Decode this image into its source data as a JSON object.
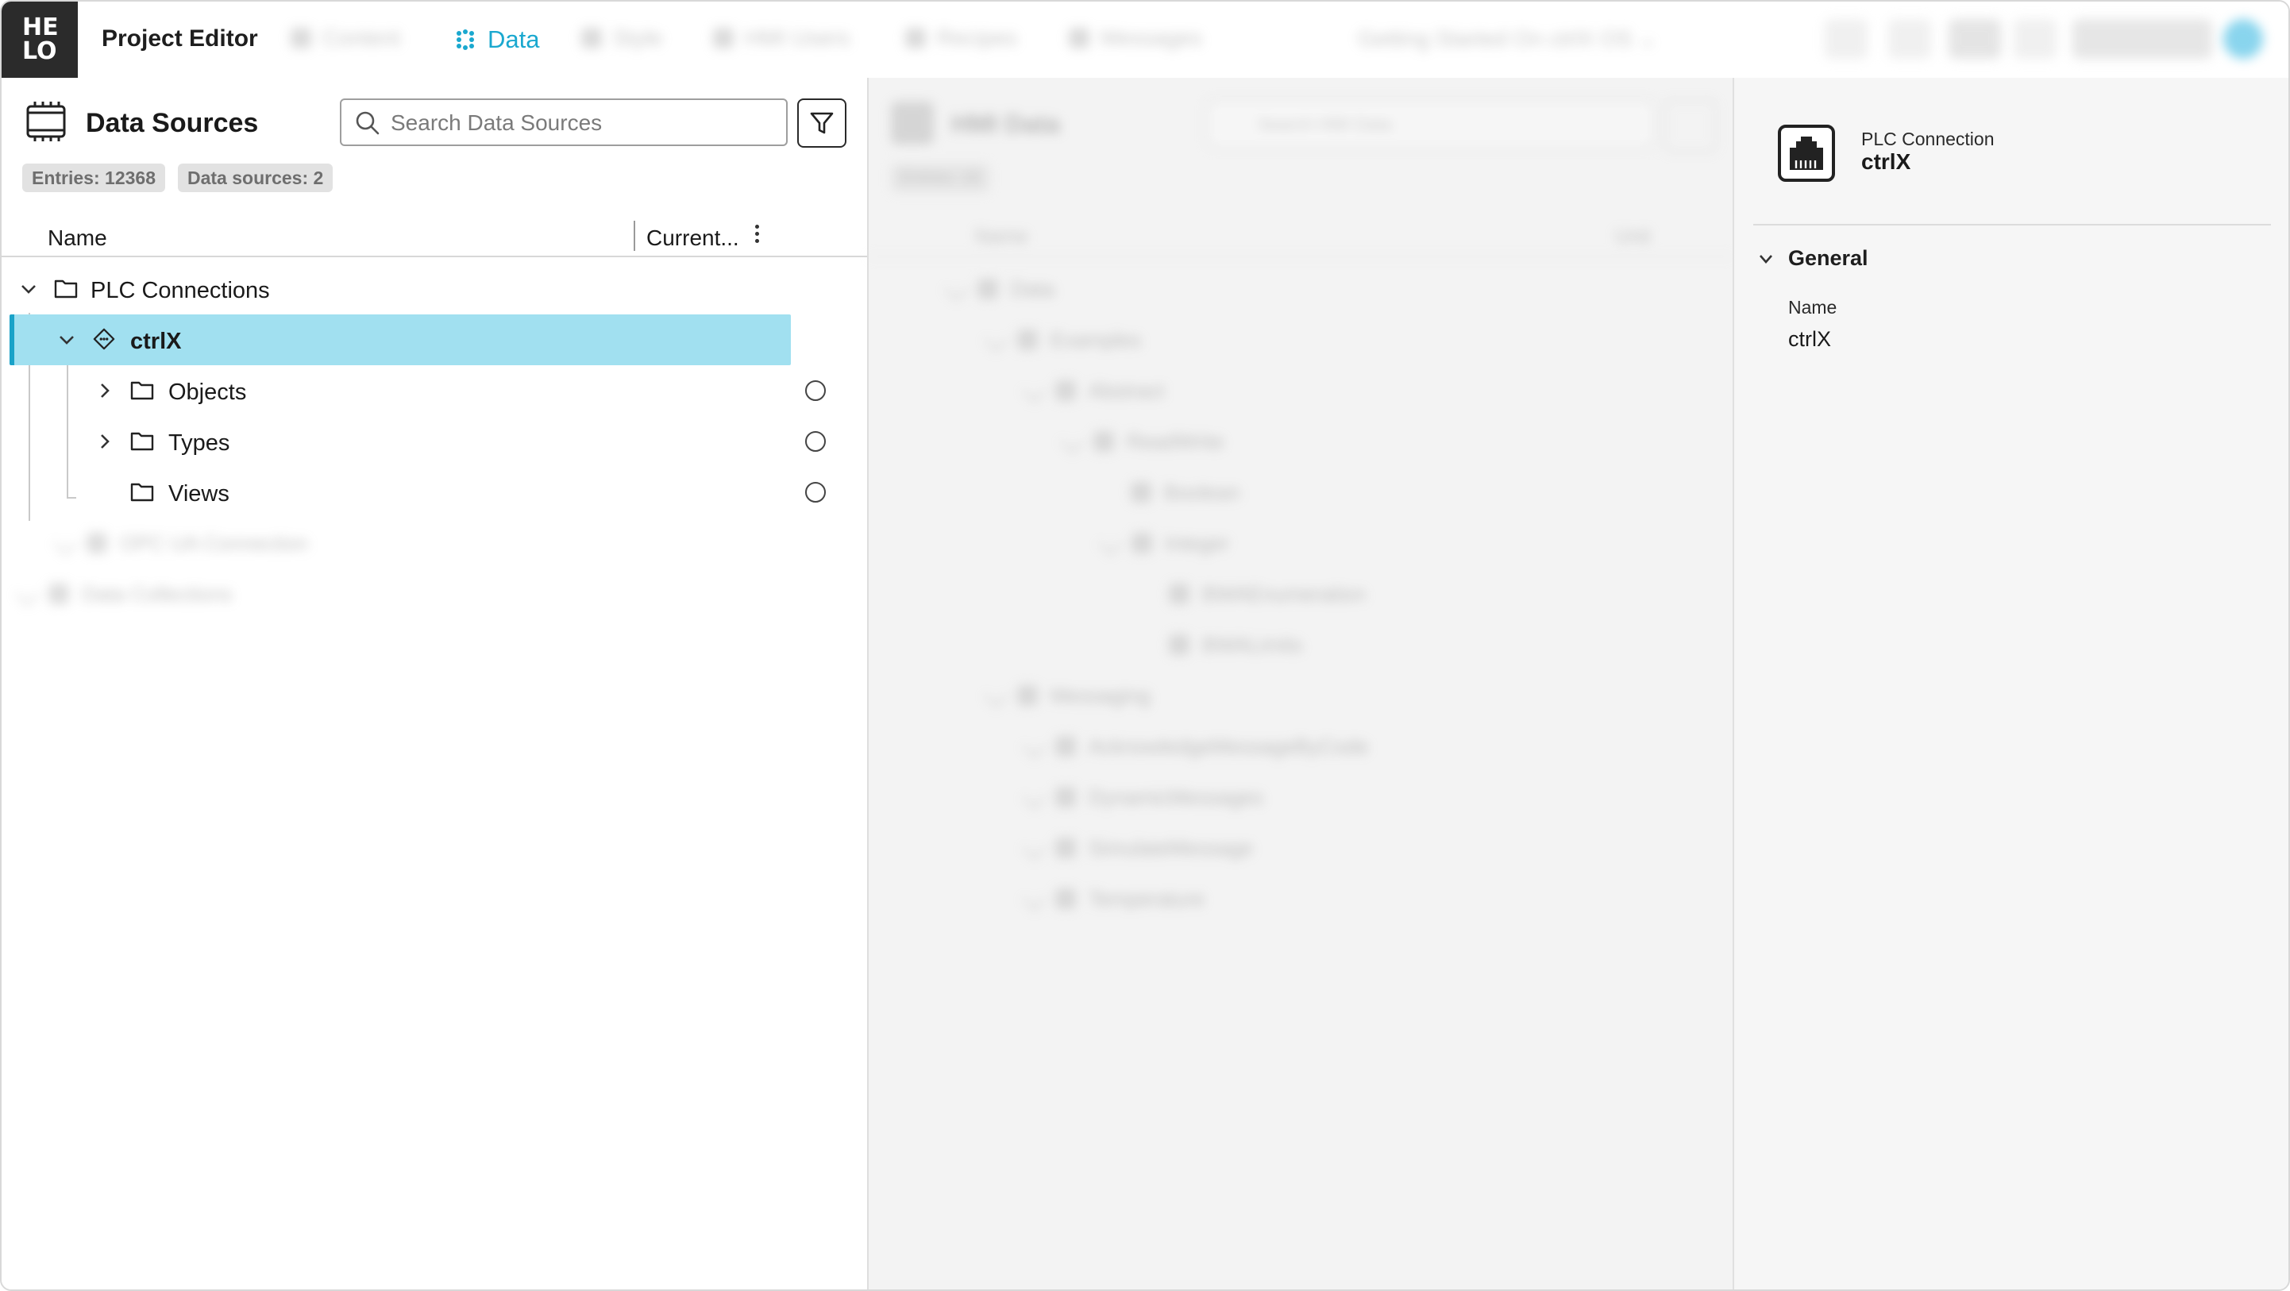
{
  "app": {
    "logo_top": "HE",
    "logo_bottom": "LO",
    "title": "Project Editor"
  },
  "nav": {
    "active_tab": "Data",
    "tabs": [
      "Content",
      "Data",
      "Style",
      "HMI Users",
      "Recipes",
      "Messages"
    ],
    "project": "Getting Started On ctrlX OS"
  },
  "data_sources": {
    "title": "Data Sources",
    "search_placeholder": "Search Data Sources",
    "entries_badge": "Entries: 12368",
    "sources_badge": "Data sources: 2",
    "col_name": "Name",
    "col_current": "Current...",
    "tree": {
      "root": "PLC Connections",
      "selected": "ctrlX",
      "children": [
        "Objects",
        "Types",
        "Views"
      ],
      "other_connection": "OPC UA Connection",
      "data_collections": "Data Collections"
    }
  },
  "hmi_data": {
    "title": "HMI Data",
    "search_placeholder": "Search HMI Data",
    "badge": "Entries: 16",
    "col_name": "Name",
    "col_unit": "Unit",
    "rows": [
      "Data",
      "Examples",
      "Abstract",
      "ReadWrite",
      "Boolean",
      "Integer",
      "BWAEnumeration",
      "BWALimits",
      "Messaging",
      "AcknowledgeMessageByCode",
      "DynamicMessages",
      "SimulateMessage",
      "Temperature"
    ]
  },
  "inspector": {
    "type": "PLC Connection",
    "name": "ctrlX",
    "section": "General",
    "field_label": "Name",
    "field_value": "ctrlX"
  },
  "colors": {
    "accent": "#1aa8cf",
    "selection": "#a1e0f0",
    "logo_bg": "#2b2b2b"
  }
}
